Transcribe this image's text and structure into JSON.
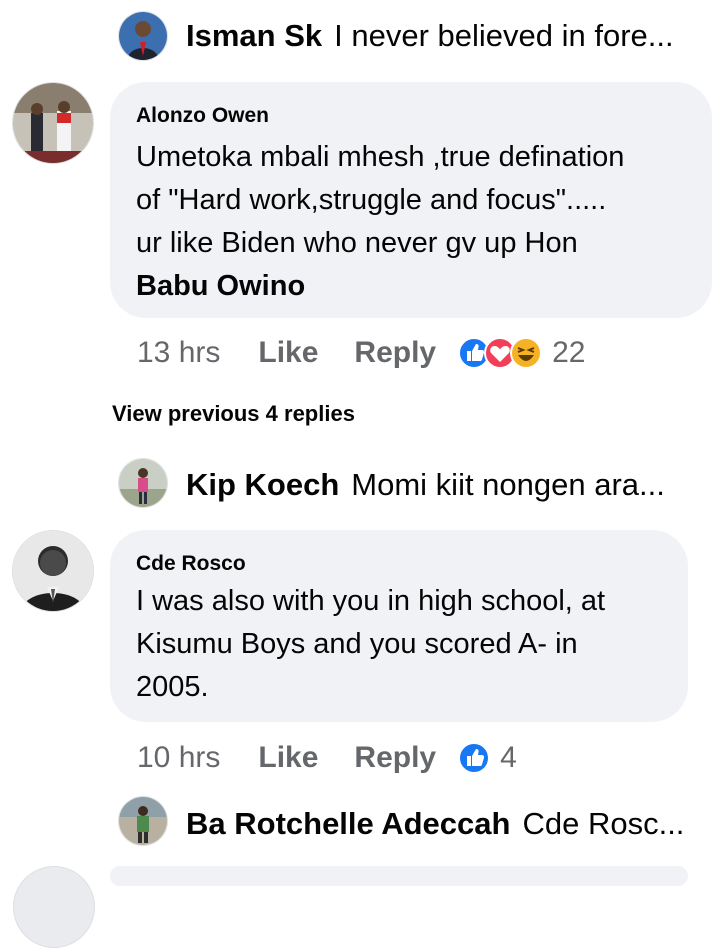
{
  "replies": [
    {
      "name": "Isman Sk",
      "snippet": "I never believed in fore..."
    },
    {
      "name": "Kip Koech",
      "snippet": "Momi kiit nongen ara..."
    },
    {
      "name": "Ba Rotchelle Adeccah",
      "snippet": "Cde Rosc..."
    }
  ],
  "comments": [
    {
      "author": "Alonzo Owen",
      "lines": [
        "Umetoka mbali mhesh ,true defination",
        "of \"Hard work,struggle and focus\".....",
        "ur like Biden who never gv up Hon"
      ],
      "tag": "Babu Owino",
      "time": "13 hrs",
      "like": "Like",
      "reply": "Reply",
      "reaction_icons": [
        "like-icon",
        "love-icon",
        "haha-icon"
      ],
      "reaction_count": "22"
    },
    {
      "author": "Cde Rosco",
      "lines": [
        "I was also with you in high school, at",
        "Kisumu Boys and you scored A- in",
        "2005."
      ],
      "time": "10 hrs",
      "like": "Like",
      "reply": "Reply",
      "reaction_icons": [
        "like-icon"
      ],
      "reaction_count": "4"
    }
  ],
  "view_previous": "View previous 4 replies",
  "colors": {
    "bubble": "#f0f2f5",
    "meta": "#65676b",
    "like_blue": "#1877f2",
    "love_red": "#f33e58",
    "haha_yellow": "#f7b125"
  }
}
